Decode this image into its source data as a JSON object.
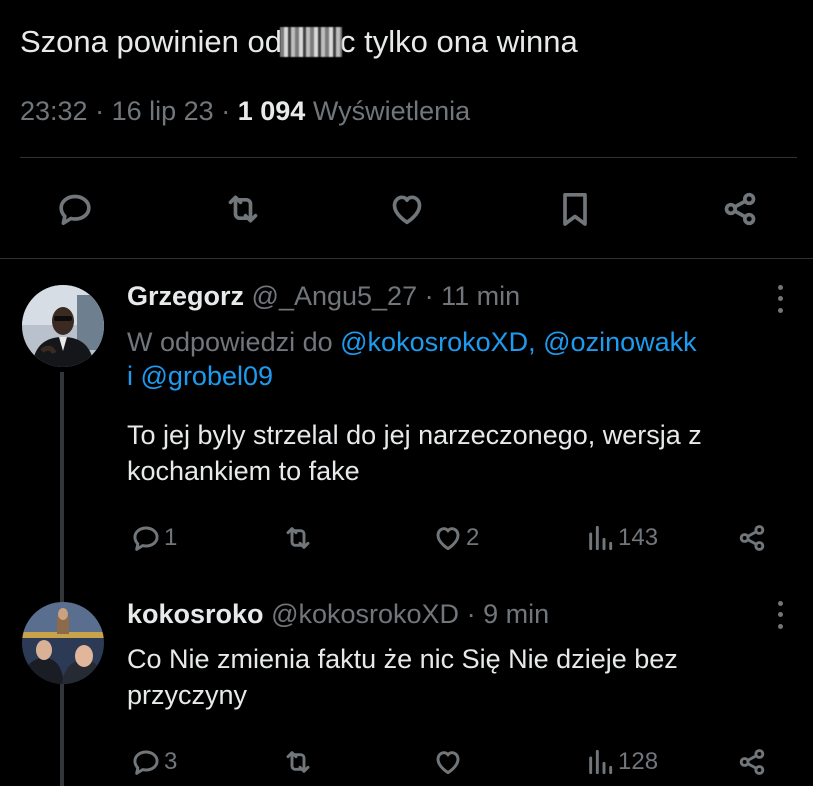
{
  "tweet": {
    "text_before": "Szona powinien od",
    "text_after": "c tylko ona winna",
    "time": "23:32",
    "sep1": "·",
    "date": "16 lip 23",
    "sep2": "·",
    "views_count": "1 094",
    "views_label": "Wyświetlenia"
  },
  "tweet_actions": [
    "reply-icon",
    "retweet-icon",
    "like-icon",
    "bookmark-icon",
    "share-icon"
  ],
  "replies": [
    {
      "name": "Grzegorz",
      "handle": "@_Angu5_27",
      "sep": "·",
      "time": "11 min",
      "replying_prefix": "W odpowiedzi do",
      "mention1": "@kokosrokoXD,",
      "mention2": "@ozinowakk",
      "mention_joiner": "i",
      "mention3": "@grobel09",
      "text": "To jej byly strzelal do jej narzeczonego, wersja z kochankiem to fake",
      "reply_count": "1",
      "retweet_count": "",
      "like_count": "2",
      "views_count": "143"
    },
    {
      "name": "kokosroko",
      "handle": "@kokosrokoXD",
      "sep": "·",
      "time": "9 min",
      "text": "Co Nie zmienia faktu że nic Się Nie dzieje bez przyczyny",
      "reply_count": "3",
      "retweet_count": "",
      "like_count": "",
      "views_count": "128"
    }
  ],
  "colors": {
    "background": "#000000",
    "text": "#e7e9ea",
    "muted": "#71767b",
    "link": "#1d9bf0",
    "divider": "#2f3336"
  }
}
